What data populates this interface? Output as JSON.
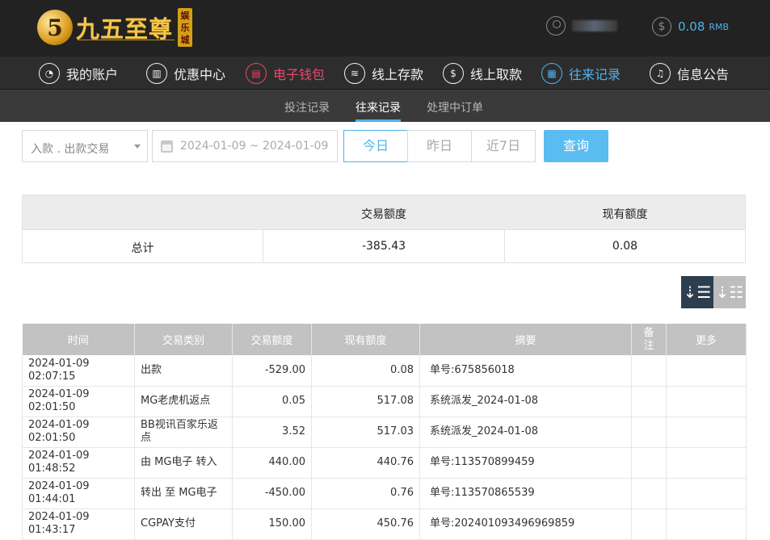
{
  "header": {
    "logo_badge": "5",
    "logo_text": "九五至尊",
    "logo_side": "娱乐城",
    "balance": "0.08",
    "currency": "RMB"
  },
  "mainnav": [
    {
      "label": "我的账户",
      "icon": "user-icon"
    },
    {
      "label": "优惠中心",
      "icon": "gift-icon"
    },
    {
      "label": "电子钱包",
      "icon": "wallet-icon"
    },
    {
      "label": "线上存款",
      "icon": "deposit-icon"
    },
    {
      "label": "线上取款",
      "icon": "withdraw-icon"
    },
    {
      "label": "往来记录",
      "icon": "records-icon"
    },
    {
      "label": "信息公告",
      "icon": "bell-icon"
    }
  ],
  "subnav": [
    {
      "label": "投注记录"
    },
    {
      "label": "往来记录"
    },
    {
      "label": "处理中订单"
    }
  ],
  "filters": {
    "type_select": "入款 . 出款交易",
    "date_range": "2024-01-09 ~ 2024-01-09",
    "quick": [
      "今日",
      "昨日",
      "近7日"
    ],
    "query_label": "查询"
  },
  "summary": {
    "headers": [
      "",
      "交易额度",
      "现有额度"
    ],
    "row": [
      "总计",
      "-385.43",
      "0.08"
    ]
  },
  "table": {
    "headers": [
      "时间",
      "交易类别",
      "交易额度",
      "现有额度",
      "摘要",
      "备注",
      "更多"
    ],
    "rows": [
      [
        "2024-01-09 02:07:15",
        "出款",
        "-529.00",
        "0.08",
        "单号:675856018",
        "",
        ""
      ],
      [
        "2024-01-09 02:01:50",
        "MG老虎机返点",
        "0.05",
        "517.08",
        "系统派发_2024-01-08",
        "",
        ""
      ],
      [
        "2024-01-09 02:01:50",
        "BB视讯百家乐返点",
        "3.52",
        "517.03",
        "系统派发_2024-01-08",
        "",
        ""
      ],
      [
        "2024-01-09 01:48:52",
        "由 MG电子 转入",
        "440.00",
        "440.76",
        "单号:113570899459",
        "",
        ""
      ],
      [
        "2024-01-09 01:44:01",
        "转出 至 MG电子",
        "-450.00",
        "0.76",
        "单号:113570865539",
        "",
        ""
      ],
      [
        "2024-01-09 01:43:17",
        "CGPAY支付",
        "150.00",
        "450.76",
        "单号:20240109349696985​9",
        "",
        ""
      ]
    ]
  },
  "colors": {
    "accent_blue": "#4fb2ec",
    "active_red": "#e9486b",
    "header_bg": "#222222"
  }
}
